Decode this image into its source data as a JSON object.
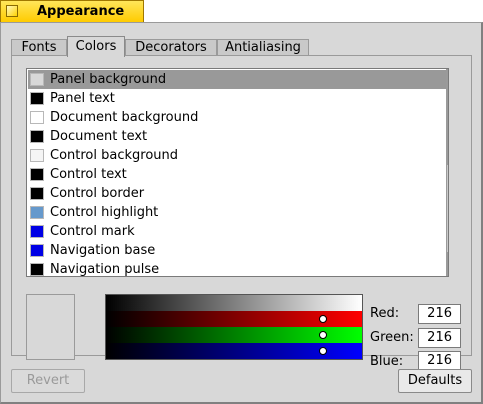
{
  "window": {
    "title": "Appearance"
  },
  "tabs": [
    {
      "label": "Fonts",
      "active": false
    },
    {
      "label": "Colors",
      "active": true
    },
    {
      "label": "Decorators",
      "active": false
    },
    {
      "label": "Antialiasing",
      "active": false
    }
  ],
  "color_list": {
    "items": [
      {
        "label": "Panel background",
        "color": "#d8d8d8",
        "selected": true
      },
      {
        "label": "Panel text",
        "color": "#000000"
      },
      {
        "label": "Document background",
        "color": "#ffffff"
      },
      {
        "label": "Document text",
        "color": "#000000"
      },
      {
        "label": "Control background",
        "color": "#f5f5f5"
      },
      {
        "label": "Control text",
        "color": "#000000"
      },
      {
        "label": "Control border",
        "color": "#000000"
      },
      {
        "label": "Control highlight",
        "color": "#6699cc"
      },
      {
        "label": "Control mark",
        "color": "#0000e5"
      },
      {
        "label": "Navigation base",
        "color": "#0000e5"
      },
      {
        "label": "Navigation pulse",
        "color": "#000000"
      }
    ],
    "scroll_position": 0.0,
    "scroll_visible_fraction": 0.45
  },
  "color_editor": {
    "preview_color": "#d8d8d8",
    "channels": [
      {
        "label": "Red:",
        "value": "216",
        "color": "#ff0000"
      },
      {
        "label": "Green:",
        "value": "216",
        "color": "#00ff00"
      },
      {
        "label": "Blue:",
        "value": "216",
        "color": "#0000ff"
      }
    ]
  },
  "buttons": {
    "revert": "Revert",
    "defaults": "Defaults"
  },
  "colors": {
    "title_tab": "#ffd200",
    "selection": "#999999",
    "panel": "#d8d8d8"
  },
  "icons": {
    "close": "close-box-icon",
    "scroll_up": "arrow-up-icon",
    "scroll_down": "arrow-down-icon"
  }
}
